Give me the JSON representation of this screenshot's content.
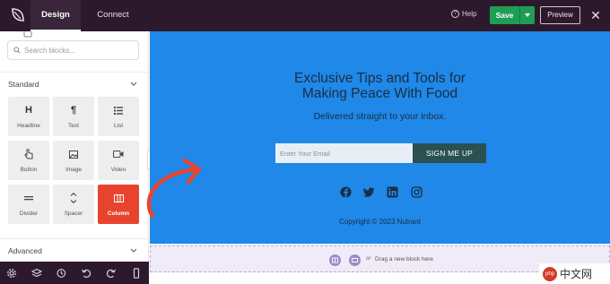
{
  "header": {
    "tabs": [
      {
        "label": "Design",
        "active": true
      },
      {
        "label": "Connect",
        "active": false
      }
    ],
    "help_label": "Help",
    "save_label": "Save",
    "preview_label": "Preview",
    "close_glyph": "✕"
  },
  "sidebar": {
    "search_placeholder": "Search blocks...",
    "sections": [
      {
        "title": "Standard",
        "expanded": true
      },
      {
        "title": "Advanced",
        "expanded": false
      }
    ],
    "blocks": [
      {
        "label": "Headline",
        "icon": "headline-icon",
        "glyph": "H"
      },
      {
        "label": "Text",
        "icon": "paragraph-icon",
        "glyph": "¶"
      },
      {
        "label": "List",
        "icon": "list-icon",
        "glyph": ""
      },
      {
        "label": "Button",
        "icon": "pointer-icon",
        "glyph": ""
      },
      {
        "label": "Image",
        "icon": "image-icon",
        "glyph": ""
      },
      {
        "label": "Video",
        "icon": "video-icon",
        "glyph": ""
      },
      {
        "label": "Divider",
        "icon": "divider-icon",
        "glyph": ""
      },
      {
        "label": "Spacer",
        "icon": "spacer-icon",
        "glyph": ""
      },
      {
        "label": "Column",
        "icon": "columns-icon",
        "glyph": "",
        "highlighted": true
      }
    ],
    "bottom_icons": [
      "settings-icon",
      "layers-icon",
      "history-icon",
      "undo-icon",
      "redo-icon",
      "mobile-preview-icon"
    ]
  },
  "canvas": {
    "headline_line1": "Exclusive Tips and Tools for",
    "headline_line2": "Making Peace With Food",
    "subline": "Delivered straight to your inbox.",
    "email_placeholder": "Enter Your Email",
    "signup_label": "SIGN ME UP",
    "social_icons": [
      "facebook-icon",
      "twitter-icon",
      "linkedin-icon",
      "instagram-icon"
    ],
    "copyright": "Copyright © 2023 Nutrant",
    "background_color": "#1f88e8",
    "button_color": "#2a5052"
  },
  "dropzone": {
    "or_label": "or",
    "text": "Drag a new block here"
  },
  "watermark": {
    "logo_text": "php",
    "text": "中文网"
  },
  "colors": {
    "topbar": "#2c1a2c",
    "save": "#1f9d55",
    "highlight_block": "#e8442d",
    "annotation_arrow": "#e8442d"
  }
}
